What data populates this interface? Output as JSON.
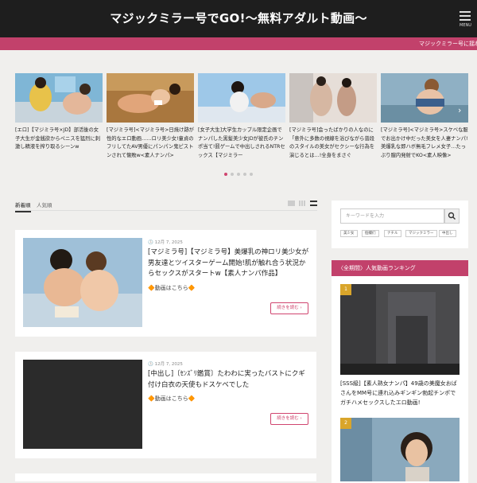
{
  "site": {
    "title": "マジックミラー号でGO!〜無料アダルト動画〜",
    "menu_label": "MENU"
  },
  "ticker": {
    "text": "マジックミラー号に揺れる"
  },
  "carousel": {
    "items": [
      {
        "caption": "[エロ]【マジミラ号×JD】部活後の女子大生が金銭欲からペニスを猛烈に刺激し精液を搾り取るシーンw"
      },
      {
        "caption": "[マジミラ号]<マジミラ号>日焼け跡が性的なエロ動画……ロリ美少女!童貞のフリしてたAV男優にパンパン鬼ピストンされて懐敗w<素人ナンパ>"
      },
      {
        "caption": "[女子大生]大学生カップル限定企画でナンパした黒髪美少女JDが彼氏のチンポ当て!罰ゲームで中出しされるNTRセックス【マジミラー"
      },
      {
        "caption": "[マジミラ号]会ったばかりの人なのに「意外に多数の視線を浴びながら普段のスタイルの美女がセクシーな行為を演じるとは…!全身をまさぐ"
      },
      {
        "caption": "[マジミラ号]<マジミラ号>スケベな服でお出かけ中だった美女を人妻ナンパ!美爆乳な即ハボ無毛フレメ女子…たっぷり膣内発射でKO<素人映像>"
      }
    ],
    "active_dot": 0,
    "dot_count": 5
  },
  "tabs": {
    "new": "新着順",
    "popular": "人気順"
  },
  "posts": [
    {
      "date": "12月 7, 2025",
      "title": "[マジミラ号]【マジミラ号】美爆乳の神ロリ美少女が男友達とツイスターゲーム開始!肌が触れ合う状況からセックスがスタートw【素人ナンパ作品】",
      "more_link": "🔶動画はこちら🔶",
      "read_more": "続きを読む ›"
    },
    {
      "date": "12月 7, 2025",
      "title": "[中出し]〔ｾﾝｽﾞﾘ鑑賞〕たわわに実ったバストにクギ付け白衣の天使もドスケベでした",
      "more_link": "🔶動画はこちら🔶",
      "read_more": "続きを読む ›"
    }
  ],
  "sidebar": {
    "search_placeholder": "キーワードを入力",
    "tags": [
      "美少女",
      "個撮们",
      "ナチル",
      "マジックミラー",
      "中出し"
    ],
    "ranking_title": "〈全期間〉人気動画ランキング",
    "ranking": [
      {
        "rank": "1",
        "caption": "[SSS級]【素人熟女ナンパ】49歳の美魔女おばさんをMM号に連れ込みギンギン勃起チンポでガチハメセックスしたエロ動画!"
      },
      {
        "rank": "2",
        "caption": ""
      }
    ]
  },
  "colors": {
    "accent": "#c2416b",
    "header_bg": "#1e1e1e",
    "rank_gold": "#d9a52b"
  }
}
